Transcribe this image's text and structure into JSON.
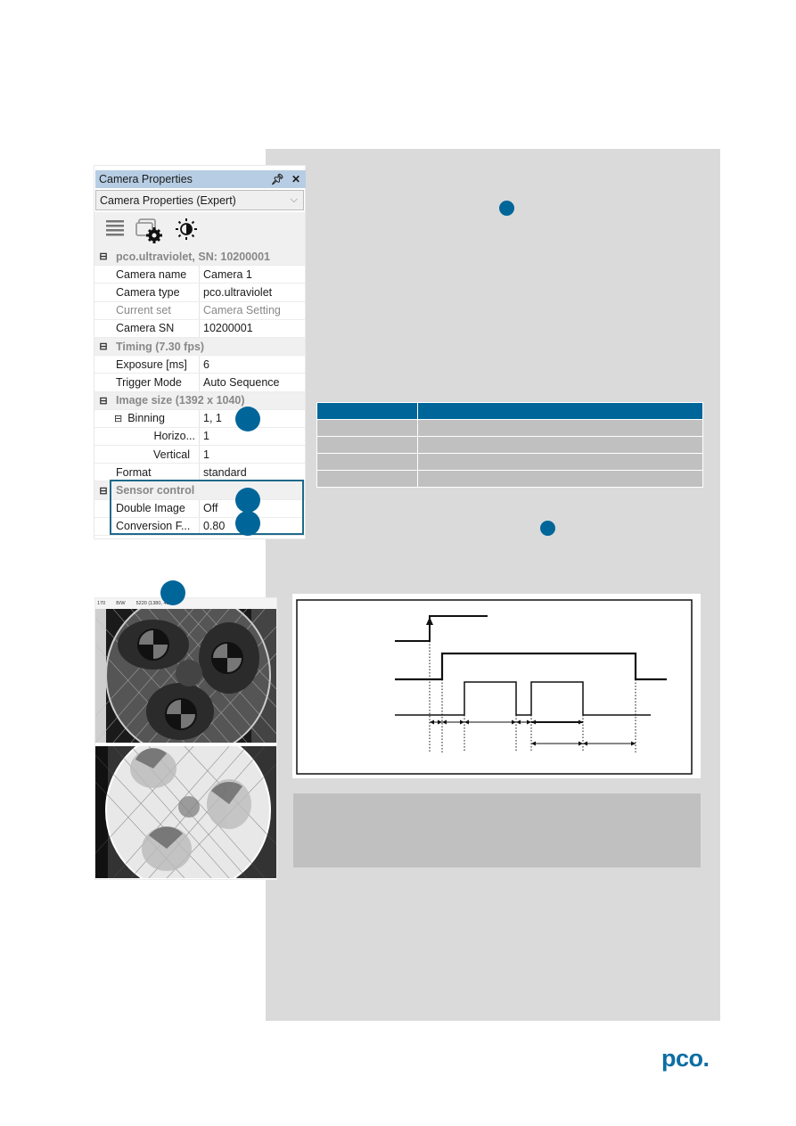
{
  "camera_properties": {
    "title": "Camera Properties",
    "pin_icon": "pin-icon",
    "close_icon": "close-icon",
    "profile_select": "Camera Properties (Expert)",
    "toolbar": [
      "list-view-icon",
      "camera-settings-icon",
      "brightness-icon"
    ],
    "groups": [
      {
        "label": "pco.ultraviolet, SN: 10200001",
        "rows": [
          {
            "name": "Camera name",
            "value": "Camera 1"
          },
          {
            "name": "Camera type",
            "value": "pco.ultraviolet"
          },
          {
            "name": "Current set",
            "value": "Camera Setting",
            "disabled": true
          },
          {
            "name": "Camera SN",
            "value": "10200001"
          }
        ]
      },
      {
        "label": "Timing (7.30 fps)",
        "rows": [
          {
            "name": "Exposure [ms]",
            "value": "6"
          },
          {
            "name": "Trigger Mode",
            "value": "Auto Sequence"
          }
        ]
      },
      {
        "label": "Image size (1392 x 1040)",
        "rows": [
          {
            "name": "Binning",
            "value": "1, 1",
            "expander": true
          },
          {
            "name": "Horizo...",
            "value": "1",
            "indent": true
          },
          {
            "name": "Vertical",
            "value": "1",
            "indent": true
          },
          {
            "name": "Format",
            "value": "standard"
          }
        ]
      },
      {
        "label": "Sensor control",
        "rows": [
          {
            "name": "Double Image",
            "value": "Off"
          },
          {
            "name": "Conversion F...",
            "value": "0.80"
          }
        ]
      }
    ]
  },
  "preview": {
    "status": [
      "170",
      "B/W",
      "5220 (1380, 418"
    ]
  },
  "table": {
    "header": [
      "",
      ""
    ],
    "rows": [
      [
        "",
        ""
      ],
      [
        "",
        ""
      ],
      [
        "",
        ""
      ],
      [
        "",
        ""
      ]
    ]
  },
  "colors": {
    "accent": "#00669a",
    "panel_bg": "#dadada",
    "table_cell": "#c0c0c0",
    "logo": "#0d6ea3"
  },
  "logo": "pco."
}
